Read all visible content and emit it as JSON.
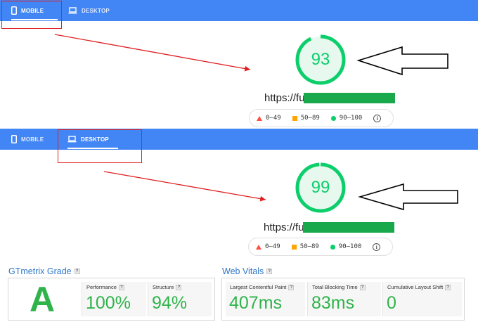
{
  "mobile_section": {
    "tabs": [
      {
        "icon": "phone-icon",
        "label": "MOBILE"
      },
      {
        "icon": "laptop-icon",
        "label": "DESKTOP"
      }
    ],
    "score": "93",
    "url": "https://fu",
    "legend": [
      "0–49",
      "50–89",
      "90–100"
    ]
  },
  "desktop_section": {
    "tabs": [
      {
        "icon": "phone-icon",
        "label": "MOBILE"
      },
      {
        "icon": "laptop-icon",
        "label": "DESKTOP"
      }
    ],
    "score": "99",
    "url": "https://fu",
    "legend": [
      "0–49",
      "50–89",
      "90–100"
    ]
  },
  "gtmetrix": {
    "grade_title": "GTmetrix Grade",
    "grade": "A",
    "performance_label": "Performance",
    "performance_value": "100%",
    "structure_label": "Structure",
    "structure_value": "94%",
    "help": "?"
  },
  "web_vitals": {
    "title": "Web Vitals",
    "lcp_label": "Largest Contentful Paint",
    "lcp_value": "407ms",
    "tbt_label": "Total Blocking Time",
    "tbt_value": "83ms",
    "cls_label": "Cumulative Layout Shift",
    "cls_value": "0",
    "help": "?"
  },
  "colors": {
    "tabbar": "#4285f4",
    "pass_green": "#0cce6b",
    "redact_green": "#1aa84d",
    "fail_red": "#ff4e42",
    "average_orange": "#ffa400",
    "annotation_red": "#e02020",
    "gtmetrix_green": "#2fb34a",
    "gtmetrix_blue": "#2e77c9"
  }
}
